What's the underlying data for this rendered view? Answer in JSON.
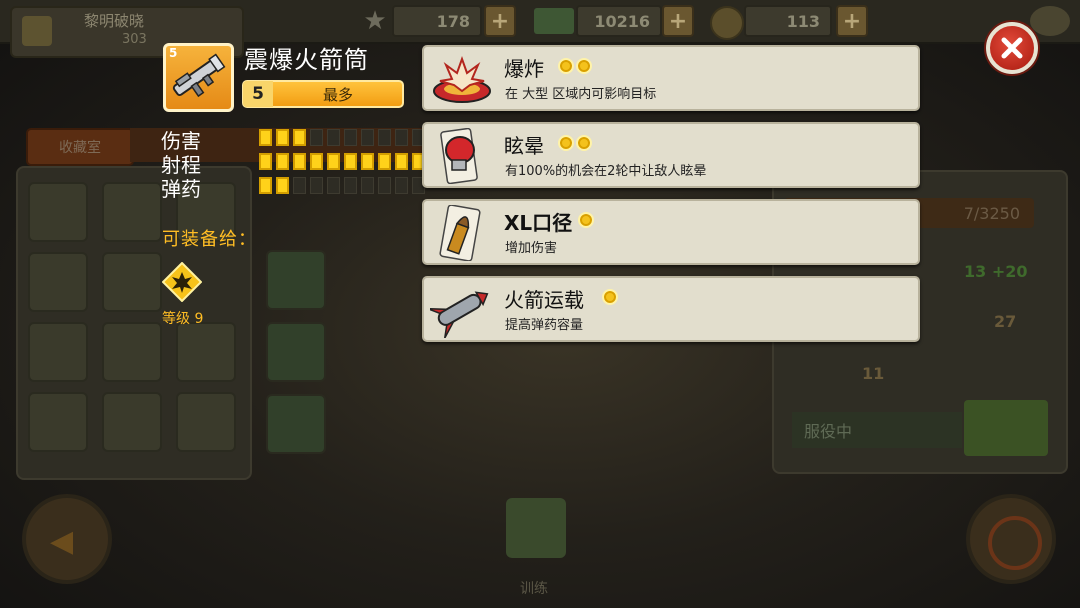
{
  "topbar": {
    "player_name": "黎明破晓",
    "player_level": "303",
    "resources": [
      {
        "icon": "star-badge-icon",
        "value": "178"
      },
      {
        "icon": "cash-stack-icon",
        "value": "10216"
      },
      {
        "icon": "gold-coin-icon",
        "value": "113"
      }
    ],
    "plus_label": "+"
  },
  "background": {
    "tab_label": "收藏室",
    "xp_text": "7/3250",
    "stat_values": [
      "13",
      "+20",
      "27",
      "11"
    ],
    "service_label": "服役中",
    "train_label": "训练"
  },
  "weapon": {
    "name": "震爆火箭筒",
    "icon_level": "5",
    "level": "5",
    "level_status": "最多",
    "stats": [
      {
        "label": "伤害",
        "filled": 3,
        "total": 10
      },
      {
        "label": "射程",
        "filled": 10,
        "total": 10
      },
      {
        "label": "弹药",
        "filled": 2,
        "total": 10
      }
    ],
    "can_equip_label": "可装备给：",
    "equip_level": "等级 9"
  },
  "abilities": [
    {
      "name": "爆炸",
      "coins": 2,
      "description": "在 大型 区域内可影响目标",
      "icon": "explosion-icon"
    },
    {
      "name": "眩晕",
      "coins": 2,
      "description": "有100%的机会在2轮中让敌人眩晕",
      "icon": "boxing-glove-icon"
    },
    {
      "name": "XL口径",
      "coins": 1,
      "description": "增加伤害",
      "icon": "bullet-icon"
    },
    {
      "name": "火箭运载",
      "coins": 1,
      "description": "提高弹药容量",
      "icon": "rocket-icon"
    }
  ],
  "colors": {
    "accent_orange": "#f29d12",
    "card_bg": "#e2decd",
    "pip_on": "#ffd21a",
    "close_red": "#c22a1c"
  }
}
